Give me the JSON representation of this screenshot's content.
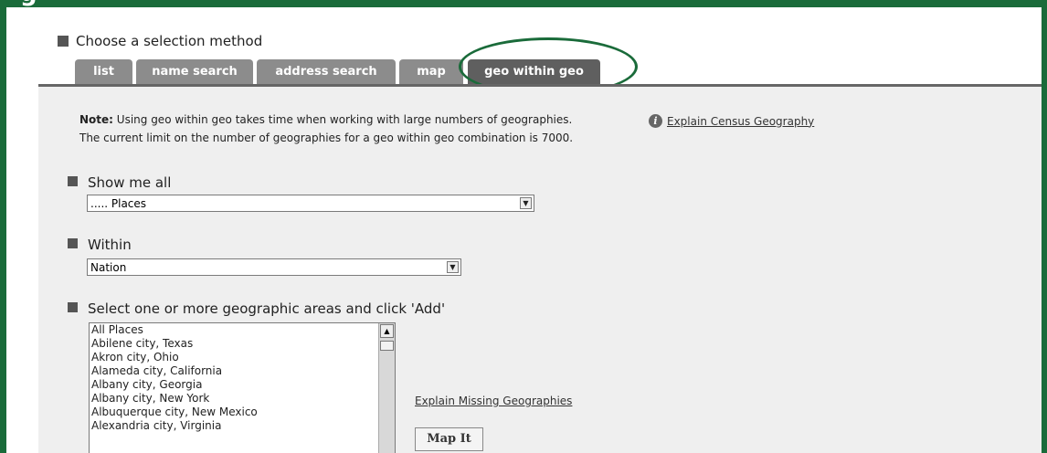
{
  "header": {
    "title_fragment": "g"
  },
  "selection": {
    "label": "Choose a selection method"
  },
  "tabs": [
    {
      "label": "list"
    },
    {
      "label": "name search"
    },
    {
      "label": "address search"
    },
    {
      "label": "map"
    },
    {
      "label": "geo within geo",
      "active": true
    }
  ],
  "note": {
    "bold": "Note:",
    "line1": " Using geo within geo takes time when working with large numbers of geographies.",
    "line2": "The current limit on the number of geographies for a geo within geo combination is 7000."
  },
  "explain_census": "Explain Census Geography",
  "show_me_all": {
    "label": "Show me all",
    "value": "..... Places"
  },
  "within": {
    "label": "Within",
    "value": "Nation"
  },
  "select_areas": {
    "label": "Select one or more geographic areas and click 'Add'",
    "items": [
      "All Places",
      "Abilene city, Texas",
      "Akron city, Ohio",
      "Alameda city, California",
      "Albany city, Georgia",
      "Albany city, New York",
      "Albuquerque city, New Mexico",
      "Alexandria city, Virginia"
    ]
  },
  "explain_missing": "Explain Missing Geographies",
  "map_it": "Map It",
  "colors": {
    "brand_green": "#1a6b3a",
    "tab_gray": "#8c8c8c",
    "tab_active": "#5f5f5f",
    "content_bg": "#efefef"
  }
}
